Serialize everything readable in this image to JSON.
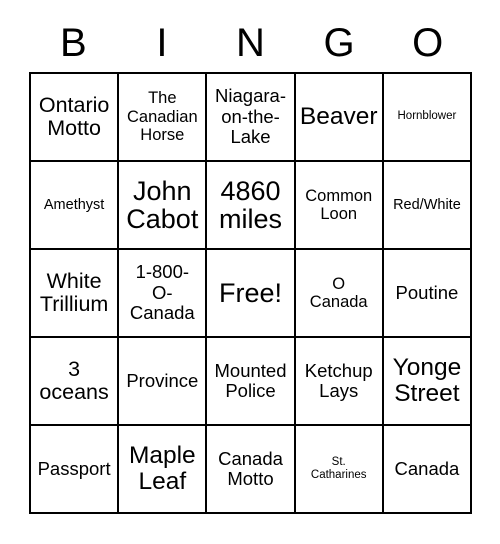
{
  "card": {
    "title": "BINGO",
    "header_letters": [
      "B",
      "I",
      "N",
      "G",
      "O"
    ],
    "colors": {
      "background": "#ffffff",
      "text": "#000000",
      "grid_line": "#000000"
    },
    "rows": [
      {
        "cells": [
          {
            "text": "Ontario\nMotto",
            "size": "xl"
          },
          {
            "text": "The\nCanadian\nHorse",
            "size": "md"
          },
          {
            "text": "Niagara-\non-the-\nLake",
            "size": "lg"
          },
          {
            "text": "Beaver",
            "size": "2xl"
          },
          {
            "text": "Hornblower",
            "size": "xs"
          }
        ]
      },
      {
        "cells": [
          {
            "text": "Amethyst",
            "size": "sm"
          },
          {
            "text": "John\nCabot",
            "size": "3xl"
          },
          {
            "text": "4860\nmiles",
            "size": "3xl"
          },
          {
            "text": "Common\nLoon",
            "size": "md"
          },
          {
            "text": "Red/White",
            "size": "sm"
          }
        ]
      },
      {
        "cells": [
          {
            "text": "White\nTrillium",
            "size": "xl"
          },
          {
            "text": "1-800-\nO-\nCanada",
            "size": "lg"
          },
          {
            "text": "Free!",
            "size": "3xl"
          },
          {
            "text": "O\nCanada",
            "size": "md"
          },
          {
            "text": "Poutine",
            "size": "lg"
          }
        ]
      },
      {
        "cells": [
          {
            "text": "3\noceans",
            "size": "xl"
          },
          {
            "text": "Province",
            "size": "lg"
          },
          {
            "text": "Mounted\nPolice",
            "size": "lg"
          },
          {
            "text": "Ketchup\nLays",
            "size": "lg"
          },
          {
            "text": "Yonge\nStreet",
            "size": "2xl"
          }
        ]
      },
      {
        "cells": [
          {
            "text": "Passport",
            "size": "lg"
          },
          {
            "text": "Maple\nLeaf",
            "size": "2xl"
          },
          {
            "text": "Canada\nMotto",
            "size": "lg"
          },
          {
            "text": "St.\nCatharines",
            "size": "xs"
          },
          {
            "text": "Canada",
            "size": "lg"
          }
        ]
      }
    ]
  }
}
